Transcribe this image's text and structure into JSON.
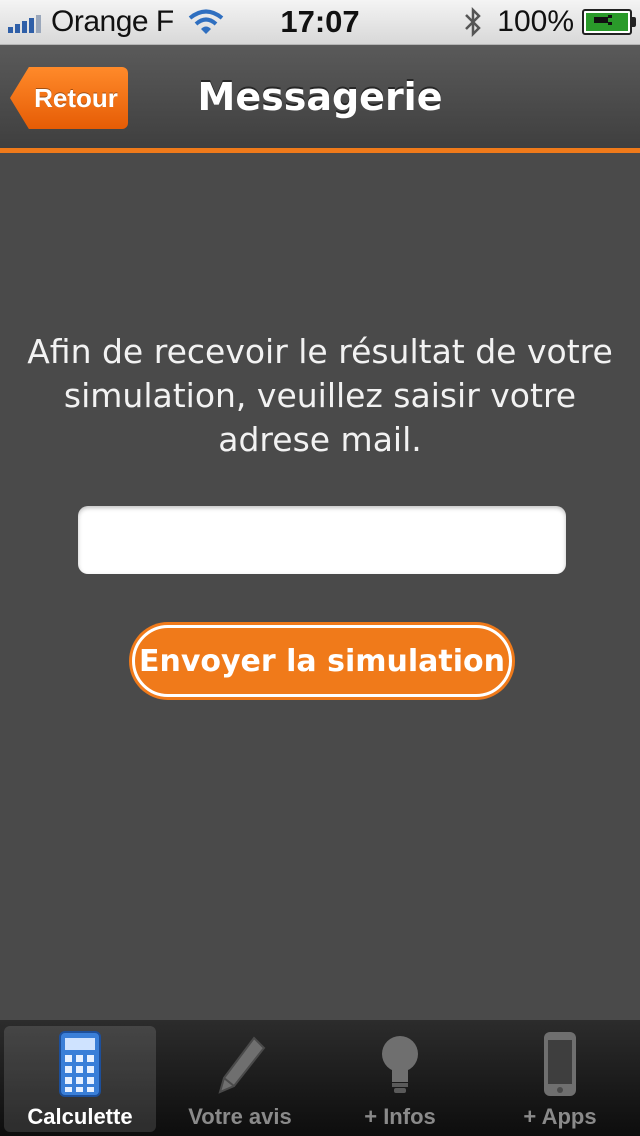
{
  "status_bar": {
    "carrier": "Orange F",
    "time": "17:07",
    "battery": "100%"
  },
  "nav": {
    "back_label": "Retour",
    "title": "Messagerie"
  },
  "form": {
    "instructions": "Afin de recevoir le résultat de votre simulation, veuillez saisir votre adrese mail.",
    "email_value": "",
    "email_placeholder": "",
    "submit_label": "Envoyer la simulation"
  },
  "tabs": [
    {
      "label": "Calculette",
      "icon": "calculator-icon",
      "active": true
    },
    {
      "label": "Votre avis",
      "icon": "pencil-icon",
      "active": false
    },
    {
      "label": "+ Infos",
      "icon": "lightbulb-icon",
      "active": false
    },
    {
      "label": "+ Apps",
      "icon": "phone-icon",
      "active": false
    }
  ],
  "colors": {
    "accent": "#f07a1a",
    "background": "#4a4a4a"
  }
}
